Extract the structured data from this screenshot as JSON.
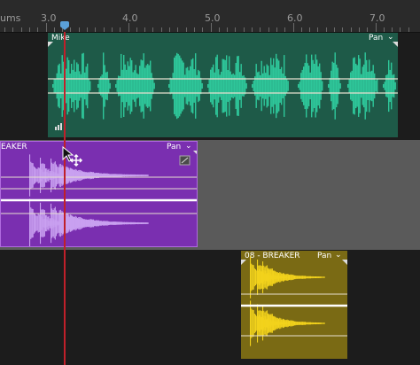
{
  "ruler": {
    "unit_label": "ums",
    "labels": [
      "3.0",
      "4.0",
      "5.0",
      "6.0",
      "7.0"
    ]
  },
  "clips": {
    "mike": {
      "name": "Mike",
      "pan_label": "Pan",
      "color": "#1e5a48",
      "wave_color": "#2ec79a"
    },
    "breaker_purple": {
      "name": "EAKER",
      "pan_label": "Pan",
      "color": "#7a2fb0",
      "wave_color": "#c9a0f0"
    },
    "breaker_yellow": {
      "name": "08 - BREAKER",
      "pan_label": "Pan",
      "color": "#7a6a14",
      "wave_color": "#f2d21c"
    }
  },
  "colors": {
    "playhead": "#c0202a",
    "playhead_marker": "#5aa0d8",
    "lane_line": "#e8e0d0"
  }
}
